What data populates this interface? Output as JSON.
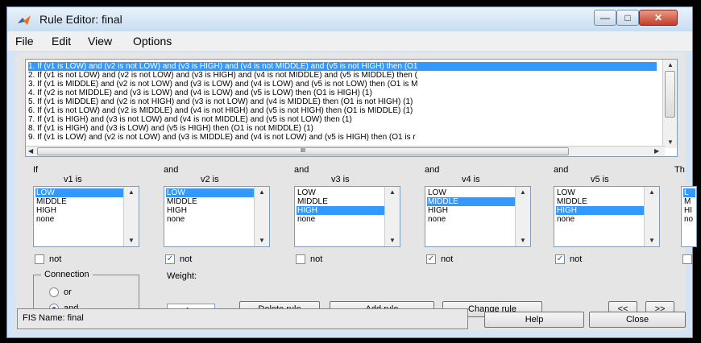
{
  "window": {
    "title": "Rule Editor: final"
  },
  "menu": [
    "File",
    "Edit",
    "View",
    "Options"
  ],
  "rules": [
    "1. If (v1 is LOW) and (v2 is not LOW) and (v3 is HIGH) and (v4 is not MIDDLE) and (v5 is not HIGH) then (O1",
    "2. If (v1 is not LOW) and (v2 is not LOW) and (v3 is HIGH) and (v4 is not MIDDLE) and (v5 is MIDDLE) then  (",
    "3. If (v1 is MIDDLE) and (v2 is not LOW) and (v3 is LOW) and (v4 is LOW) and (v5 is not LOW) then (O1 is M",
    "4. If (v2 is not MIDDLE) and (v3 is LOW) and (v4 is LOW) and (v5 is LOW) then (O1 is HIGH) (1)",
    "5. If (v1 is MIDDLE) and (v2 is not HIGH) and (v3 is not LOW) and (v4 is MIDDLE) then (O1 is not HIGH) (1)",
    "6. If (v1 is not LOW) and (v2 is MIDDLE) and (v4 is not HIGH) and (v5 is not HIGH) then (O1 is MIDDLE) (1)",
    "7. If (v1 is HIGH) and (v3 is not LOW) and (v4 is not MIDDLE) and (v5 is not LOW) then  (1)",
    "8. If (v1 is HIGH) and (v3 is LOW) and (v5 is HIGH) then (O1 is not MIDDLE) (1)",
    "9. If (v1 is LOW) and (v2 is not LOW) and (v3 is MIDDLE) and (v4 is not LOW) and (v5 is HIGH) then (O1 is r"
  ],
  "scroll_marker": "III",
  "variables": [
    {
      "conj": "If",
      "label": "v1 is",
      "options": [
        "LOW",
        "MIDDLE",
        "HIGH",
        "none"
      ],
      "selected": 0,
      "not_label": "not",
      "not_checked": false
    },
    {
      "conj": "and",
      "label": "v2 is",
      "options": [
        "LOW",
        "MIDDLE",
        "HIGH",
        "none"
      ],
      "selected": 0,
      "not_label": "not",
      "not_checked": true
    },
    {
      "conj": "and",
      "label": "v3 is",
      "options": [
        "LOW",
        "MIDDLE",
        "HIGH",
        "none"
      ],
      "selected": 2,
      "not_label": "not",
      "not_checked": false
    },
    {
      "conj": "and",
      "label": "v4 is",
      "options": [
        "LOW",
        "MIDDLE",
        "HIGH",
        "none"
      ],
      "selected": 1,
      "not_label": "not",
      "not_checked": true
    },
    {
      "conj": "and",
      "label": "v5 is",
      "options": [
        "LOW",
        "MIDDLE",
        "HIGH",
        "none"
      ],
      "selected": 2,
      "not_label": "not",
      "not_checked": true
    }
  ],
  "partial_column": {
    "conj": "Th",
    "options": [
      "L",
      "M",
      "HI",
      "no"
    ]
  },
  "connection": {
    "title": "Connection",
    "or_label": "or",
    "and_label": "and",
    "selected": "and"
  },
  "weight": {
    "label": "Weight:",
    "value": "1"
  },
  "buttons": {
    "delete": "Delete rule",
    "add": "Add rule",
    "change": "Change rule",
    "prev": "<<",
    "next": ">>",
    "help": "Help",
    "close": "Close"
  },
  "status": {
    "fis_name": "FIS Name: final"
  },
  "colors": {
    "selection": "#3399ff",
    "window_bg": "#e5e5e5"
  }
}
